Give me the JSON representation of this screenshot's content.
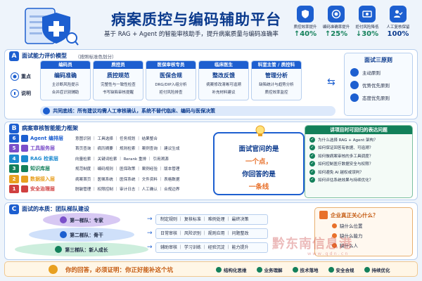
{
  "header": {
    "title": "病案质控与编码辅助平台",
    "subtitle": "基于 RAG + Agent 的智能审核助手，提升病案质量与编码准确率",
    "kpis": [
      {
        "label": "质控效率提升",
        "value": "↑40%",
        "icon": "shield-icon",
        "color": "#13805a"
      },
      {
        "label": "编码准确率提升",
        "value": "↑25%",
        "icon": "target-icon",
        "color": "#13805a"
      },
      {
        "label": "拒付风险降低",
        "value": "↓30%",
        "icon": "money-icon",
        "color": "#13805a"
      },
      {
        "label": "人工复核保留",
        "value": "100%",
        "icon": "person-check-icon",
        "color": "#0b3a8d"
      }
    ]
  },
  "section_a": {
    "tag": "A",
    "title": "面试能力评价模型",
    "subtitle": "（按照标准色划分）",
    "side_labels": [
      "重点",
      "说明"
    ],
    "columns": [
      {
        "head": "编码员",
        "main": "编码准确",
        "lines": [
          "主诊断风险提示",
          "合并症识别辅助"
        ]
      },
      {
        "head": "质控员",
        "main": "质控规范",
        "lines": [
          "完整性与一致性检查",
          "书写缺陷审核提醒"
        ]
      },
      {
        "head": "医保审核专员",
        "main": "医保合规",
        "lines": [
          "DRG/DIP入组分析",
          "拒付风险排查"
        ]
      },
      {
        "head": "临床医生",
        "main": "整改反馈",
        "lines": [
          "病案修改清晰可追溯",
          "补充材料建议"
        ]
      },
      {
        "head": "科室主管 / 质控科",
        "main": "管理分析",
        "lines": [
          "缺陷统计与趋势分析",
          "质控效率监控"
        ]
      }
    ],
    "principles_title": "面试三原则",
    "principles": [
      {
        "label": "主动原则",
        "icon": "person-icon"
      },
      {
        "label": "优势优先原则",
        "icon": "star-icon"
      },
      {
        "label": "态度优先原则",
        "icon": "heart-icon"
      }
    ],
    "baseline": "共同底线：所有建议均需人工审核确认，系统不替代临床、编码与医保决策"
  },
  "section_b": {
    "tag": "B",
    "title": "病案审核智能能力框架",
    "layers": [
      {
        "num": "6",
        "name": "Agent 编排层",
        "desc": "意图识别 ｜ 工具选择 ｜ 任务规划 ｜ 结果整合",
        "color": "#1d5fd0"
      },
      {
        "num": "5",
        "name": "工具服务层",
        "desc": "首页查询 ｜ 病历摘要 ｜ 规则检索 ｜ 案例查询 ｜ 建议生成",
        "color": "#7b4fc9"
      },
      {
        "num": "4",
        "name": "RAG 检索层",
        "desc": "向量检索 ｜ 关键词检索 ｜ Rerank 重排 ｜ 引用溯源",
        "color": "#1d8bd0"
      },
      {
        "num": "3",
        "name": "知识库层",
        "desc": "规范制度 ｜ 编码规则 ｜ 医保政策 ｜ 案例经验 ｜ 版本管理",
        "color": "#13805a"
      },
      {
        "num": "2",
        "name": "数据接入层",
        "desc": "病案首页 ｜ 医嘱系统 ｜ 医保系统 ｜ 文件资料 ｜ 表格数据",
        "color": "#e8a020"
      },
      {
        "num": "1",
        "name": "安全治理层",
        "desc": "脱敏管理 ｜ 权限控制 ｜ 审计日志 ｜ 人工确认 ｜ 合规边界",
        "color": "#d04040"
      }
    ],
    "bubble": {
      "line1": "面试官问的是",
      "line2": "一个点，",
      "line3": "你回答的是",
      "line4": "一条线"
    },
    "qa_title": "讲项目时可回归的表达问题",
    "qa": [
      "为什么选择 RAG + Agent 架构？",
      "如何保证回答有依据、可追溯？",
      "如何做病案审核的多工具调度？",
      "如何控制医疗数据安全与权限？",
      "如何避免 AI 越权或误判？",
      "如何评估系统效果与持续优化？"
    ]
  },
  "section_c": {
    "tag": "C",
    "title": "面试的本质：团队梯队建设",
    "tiers": [
      {
        "label": "第一梯队：专家",
        "desc": "制定规则 ｜ 复核标准 ｜ 难例处理 ｜ 最终决策"
      },
      {
        "label": "第二梯队：骨干",
        "desc": "日常审核 ｜ 风险识别 ｜ 规则应用 ｜ 问题整改"
      },
      {
        "label": "第三梯队：新人成长",
        "desc": "辅助审核 ｜ 学习训练 ｜ 经验沉淀 ｜ 能力提升"
      }
    ],
    "enterprise_title": "企业真正关心什么？",
    "enterprise_items": [
      "缺什么位置",
      "缺什么能力",
      "缺什么人"
    ],
    "watermark": "黔东南信息港",
    "watermark_url": "www.qdn.cn"
  },
  "footer": {
    "text": "你的回答，必须证明：你正好能补这个坑",
    "tags": [
      "结构化思维",
      "业务理解",
      "技术落地",
      "安全合规",
      "持续优化"
    ]
  }
}
